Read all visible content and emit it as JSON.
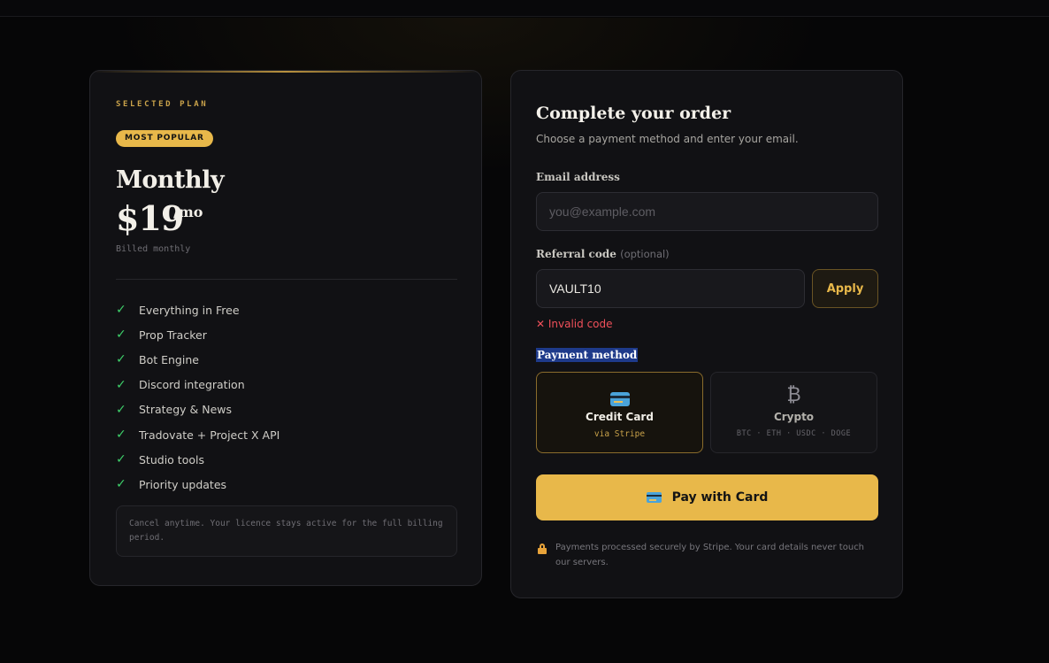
{
  "plan": {
    "eyebrow": "SELECTED PLAN",
    "badge": "MOST POPULAR",
    "name": "Monthly",
    "price": "$19",
    "price_unit": "/mo",
    "billing": "Billed monthly",
    "features": [
      "Everything in Free",
      "Prop Tracker",
      "Bot Engine",
      "Discord integration",
      "Strategy & News",
      "Tradovate + Project X API",
      "Studio tools",
      "Priority updates"
    ],
    "note": "Cancel anytime. Your licence stays active for the full billing period."
  },
  "order": {
    "title": "Complete your order",
    "subtitle": "Choose a payment method and enter your email.",
    "email_label": "Email address",
    "email_placeholder": "you@example.com",
    "email_value": "",
    "referral_label": "Referral code",
    "referral_optional": "(optional)",
    "referral_value": "VAULT10",
    "apply_label": "Apply",
    "error": "✕ Invalid code",
    "payment_method_label": "Payment method",
    "methods": {
      "card": {
        "title": "Credit Card",
        "sub": "via Stripe",
        "icon": "credit-card-icon"
      },
      "crypto": {
        "title": "Crypto",
        "sub": "BTC · ETH · USDC · DOGE",
        "icon": "bitcoin-icon",
        "glyph": "₿"
      }
    },
    "pay_label": "Pay with Card",
    "secure_note": "Payments processed securely by Stripe. Your card details never touch our servers."
  },
  "colors": {
    "accent": "#e8b84a",
    "success": "#3ecf6a",
    "error": "#f0505a",
    "background": "#060607",
    "card": "#111114"
  }
}
